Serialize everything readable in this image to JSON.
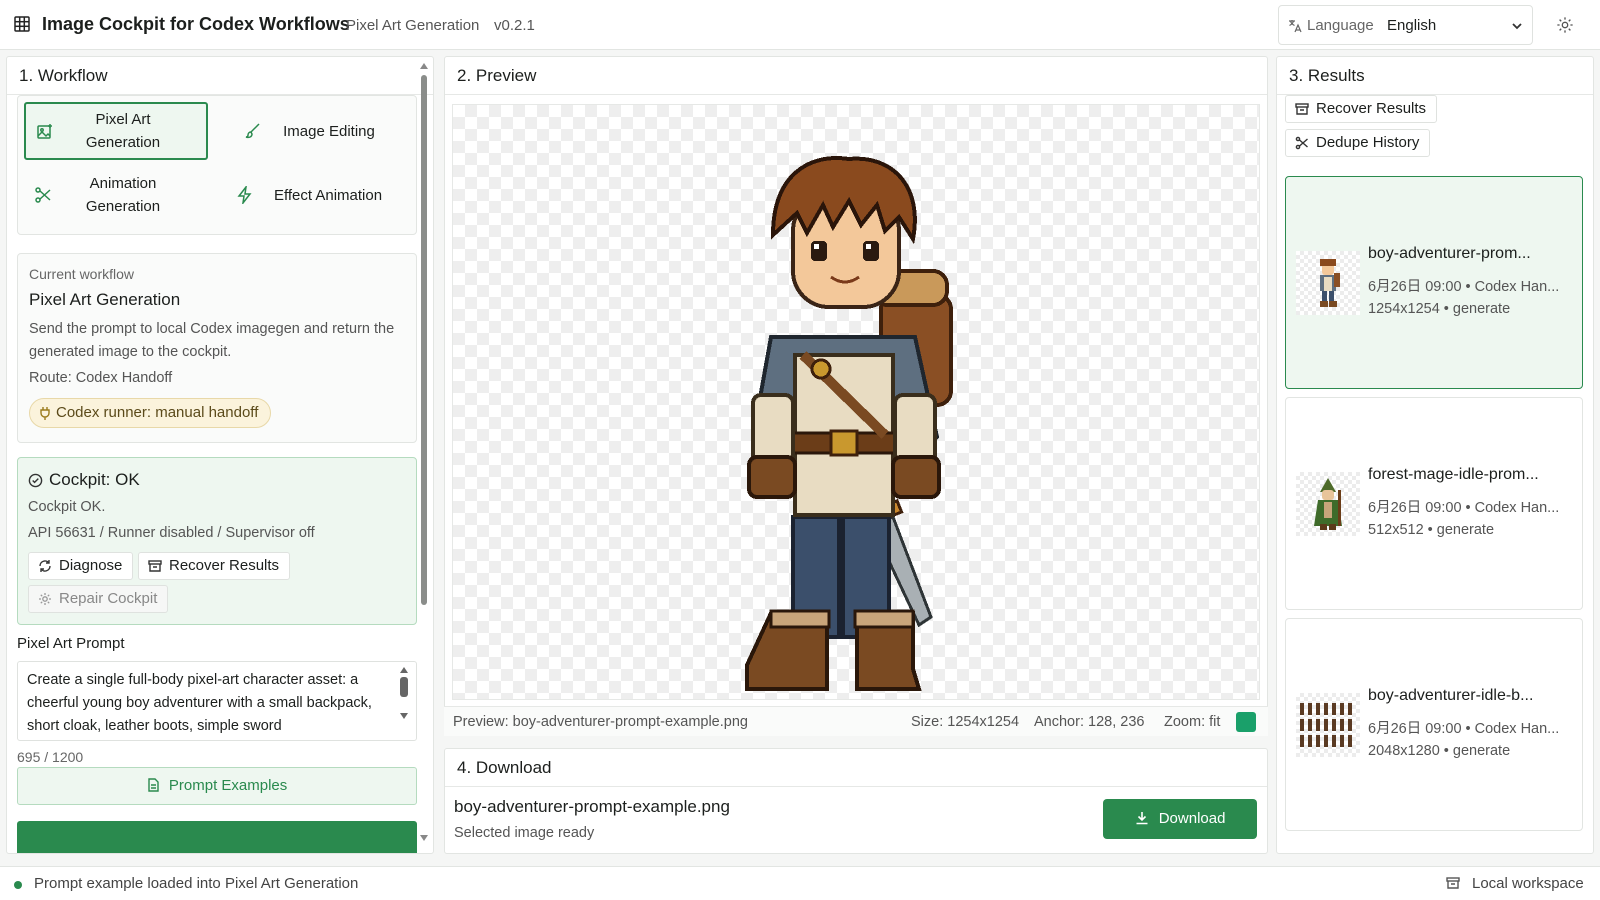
{
  "app": {
    "title": "Image Cockpit for Codex Workflows",
    "subtitle": "Pixel Art Generation",
    "version": "v0.2.1",
    "language_label": "Language",
    "language_value": "English",
    "accent_color": "#2a8a4e"
  },
  "workflow": {
    "heading": "1. Workflow",
    "options": [
      {
        "label": "Pixel Art Generation",
        "icon": "image-plus-icon",
        "active": true
      },
      {
        "label": "Image Editing",
        "icon": "brush-icon",
        "active": false
      },
      {
        "label": "Animation Generation",
        "icon": "scissors-icon",
        "active": false
      },
      {
        "label": "Effect Animation",
        "icon": "lightning-icon",
        "active": false
      }
    ],
    "current": {
      "label": "Current workflow",
      "title": "Pixel Art Generation",
      "description": "Send the prompt to local Codex imagegen and return the generated image to the cockpit.",
      "route": "Route: Codex Handoff",
      "runner_badge": "Codex runner: manual handoff"
    },
    "cockpit": {
      "title": "Cockpit: OK",
      "line1": "Cockpit OK.",
      "line2": "API 56631 / Runner disabled / Supervisor off",
      "diagnose": "Diagnose",
      "recover": "Recover Results",
      "repair": "Repair Cockpit"
    },
    "prompt": {
      "label": "Pixel Art Prompt",
      "value": "Create a single full-body pixel-art character asset: a cheerful young boy adventurer with a small backpack, short cloak, leather boots, simple sword",
      "count": "695 / 1200",
      "examples_button": "Prompt Examples"
    }
  },
  "preview": {
    "heading": "2. Preview",
    "file": "Preview: boy-adventurer-prompt-example.png",
    "size": "Size: 1254x1254",
    "anchor": "Anchor: 128, 236",
    "zoom": "Zoom: fit",
    "bg_swatch_color": "#1aa06a"
  },
  "download": {
    "heading": "4. Download",
    "file": "boy-adventurer-prompt-example.png",
    "status": "Selected image ready",
    "button": "Download"
  },
  "results": {
    "heading": "3. Results",
    "recover": "Recover Results",
    "dedupe": "Dedupe History",
    "items": [
      {
        "title": "boy-adventurer-prom...",
        "meta": "6月26日 09:00 • Codex Han...",
        "dims": "1254x1254 • generate",
        "selected": true
      },
      {
        "title": "forest-mage-idle-prom...",
        "meta": "6月26日 09:00 • Codex Han...",
        "dims": "512x512 • generate",
        "selected": false
      },
      {
        "title": "boy-adventurer-idle-b...",
        "meta": "6月26日 09:00 • Codex Han...",
        "dims": "2048x1280 • generate",
        "selected": false
      }
    ]
  },
  "status": {
    "message": "Prompt example loaded into Pixel Art Generation",
    "workspace": "Local workspace"
  }
}
